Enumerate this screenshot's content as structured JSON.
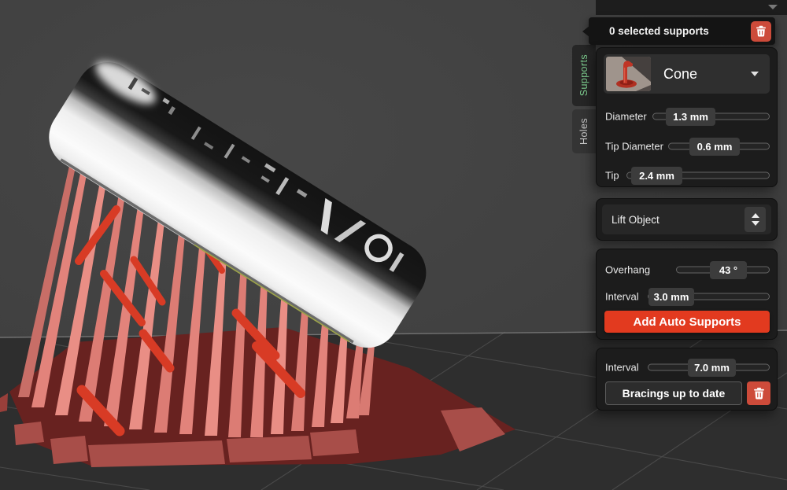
{
  "window": {
    "collapse_icon": "chevron-down-icon"
  },
  "tabs": {
    "supports_label": "Supports",
    "holes_label": "Holes"
  },
  "selection_bar": {
    "text": "0 selected supports"
  },
  "support_type": {
    "selected": "Cone"
  },
  "sliders": {
    "diameter": {
      "label": "Diameter",
      "value": "1.3 mm"
    },
    "tip_diameter": {
      "label": "Tip Diameter",
      "value": "0.6 mm"
    },
    "tip": {
      "label": "Tip",
      "value": "2.4 mm"
    },
    "overhang": {
      "label": "Overhang",
      "value": "43 °"
    },
    "interval": {
      "label": "Interval",
      "value": "3.0 mm"
    },
    "bracing_interval": {
      "label": "Interval",
      "value": "7.0 mm"
    }
  },
  "lift_object": {
    "label": "Lift Object"
  },
  "buttons": {
    "add_auto_supports": "Add Auto Supports",
    "bracings_status": "Bracings up to date"
  },
  "colors": {
    "accent_red": "#e23a1f",
    "muted_red_button": "#cd4b3a",
    "tab_active_green": "#7ecf90",
    "support_salmon": "#e2837b",
    "bracing_red": "#d83b25",
    "raft_dark_red": "#682220"
  }
}
